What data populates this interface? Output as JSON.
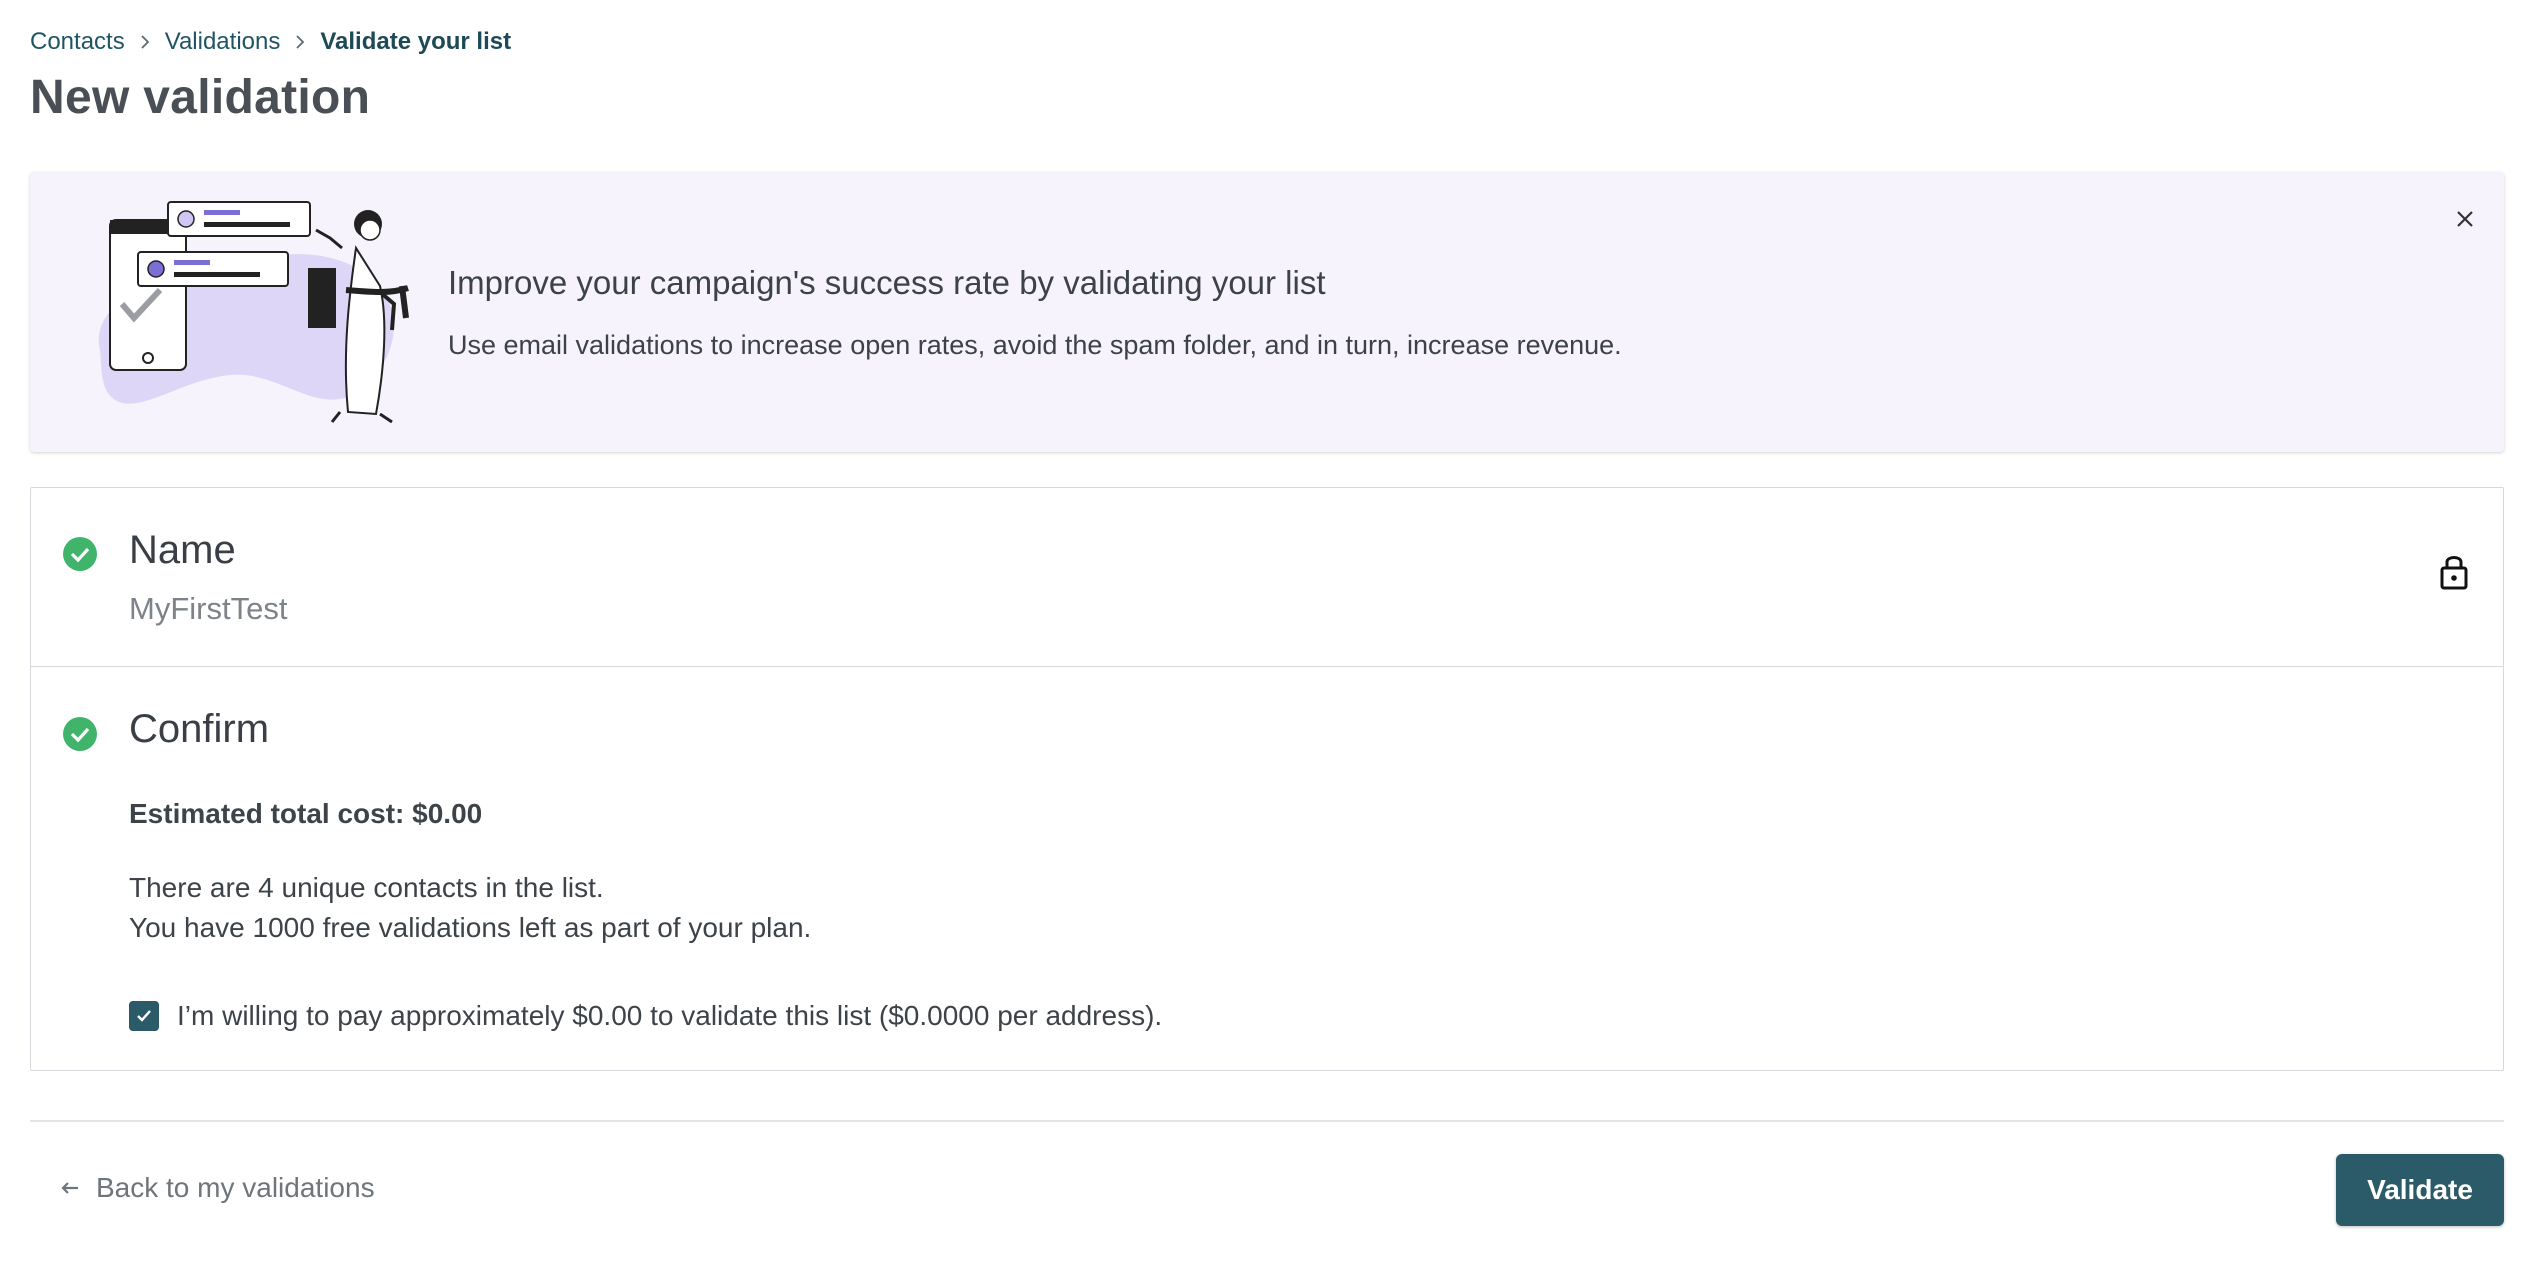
{
  "breadcrumb": {
    "items": [
      {
        "label": "Contacts"
      },
      {
        "label": "Validations"
      },
      {
        "label": "Validate your list"
      }
    ]
  },
  "page": {
    "title": "New validation"
  },
  "banner": {
    "title": "Improve your campaign's success rate by validating your list",
    "description": "Use email validations to increase open rates, avoid the spam folder, and in turn, increase revenue.",
    "illustration_icon": "list-validation-illustration",
    "close_icon": "close-icon"
  },
  "steps": {
    "name": {
      "title": "Name",
      "value": "MyFirstTest",
      "status_icon": "check-circle-icon",
      "action_icon": "lock-icon"
    },
    "confirm": {
      "title": "Confirm",
      "status_icon": "check-circle-icon",
      "estimated_cost": "Estimated total cost: $0.00",
      "info_lines": [
        "There are 4 unique contacts in the list.",
        "You have 1000 free validations left as part of your plan."
      ],
      "consent_label": "I’m willing to pay approximately $0.00 to validate this list ($0.0000 per address).",
      "consent_checked": true
    }
  },
  "footer": {
    "back_label": "Back to my validations",
    "validate_label": "Validate"
  },
  "colors": {
    "accent": "#2b5a69",
    "success": "#3fb46a",
    "banner_bg": "#f6f3fd",
    "illustration_purple": "#7b6fd6"
  }
}
